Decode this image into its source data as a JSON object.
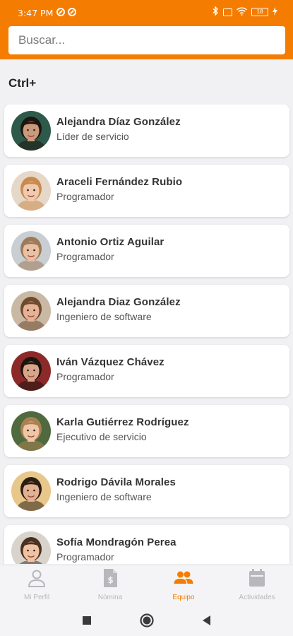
{
  "status": {
    "time": "3:47 PM",
    "battery": "18"
  },
  "search": {
    "placeholder": "Buscar..."
  },
  "section": {
    "title": "Ctrl+"
  },
  "colors": {
    "accent": "#f47c00",
    "inactive": "#b8b8bc"
  },
  "people": [
    {
      "name": "Alejandra Díaz González",
      "role": "Líder de servicio",
      "avatar": {
        "skin": "#c99a7c",
        "hair": "#1d1510",
        "bg": "#2d5a4a"
      }
    },
    {
      "name": "Araceli Fernández Rubio",
      "role": "Programador",
      "avatar": {
        "skin": "#f0c9ae",
        "hair": "#c98a4e",
        "bg": "#e6d8c8"
      }
    },
    {
      "name": "Antonio Ortiz Aguilar",
      "role": "Programador",
      "avatar": {
        "skin": "#eac0a4",
        "hair": "#9c7a5a",
        "bg": "#c9ced2"
      }
    },
    {
      "name": "Alejandra Diaz González",
      "role": "Ingeniero de software",
      "avatar": {
        "skin": "#e5b296",
        "hair": "#6e4a2e",
        "bg": "#c9b8a4"
      }
    },
    {
      "name": "Iván Vázquez Chávez",
      "role": "Programador",
      "avatar": {
        "skin": "#d9a58a",
        "hair": "#1c140e",
        "bg": "#8c2a2a"
      }
    },
    {
      "name": "Karla Gutiérrez Rodríguez",
      "role": "Ejecutivo de servicio",
      "avatar": {
        "skin": "#efc6a8",
        "hair": "#a9804f",
        "bg": "#4e6a3e"
      }
    },
    {
      "name": "Rodrigo Dávila Morales",
      "role": "Ingeniero de software",
      "avatar": {
        "skin": "#e2b092",
        "hair": "#2a1d14",
        "bg": "#e8c78a"
      }
    },
    {
      "name": "Sofía Mondragón Perea",
      "role": "Programador",
      "avatar": {
        "skin": "#eec2a2",
        "hair": "#4a3020",
        "bg": "#d8d4cc"
      }
    }
  ],
  "tabs": [
    {
      "label": "Mi Perfil",
      "icon": "person-icon",
      "active": false
    },
    {
      "label": "Nómina",
      "icon": "payroll-icon",
      "active": false
    },
    {
      "label": "Equipo",
      "icon": "team-icon",
      "active": true
    },
    {
      "label": "Actividades",
      "icon": "calendar-icon",
      "active": false
    }
  ]
}
